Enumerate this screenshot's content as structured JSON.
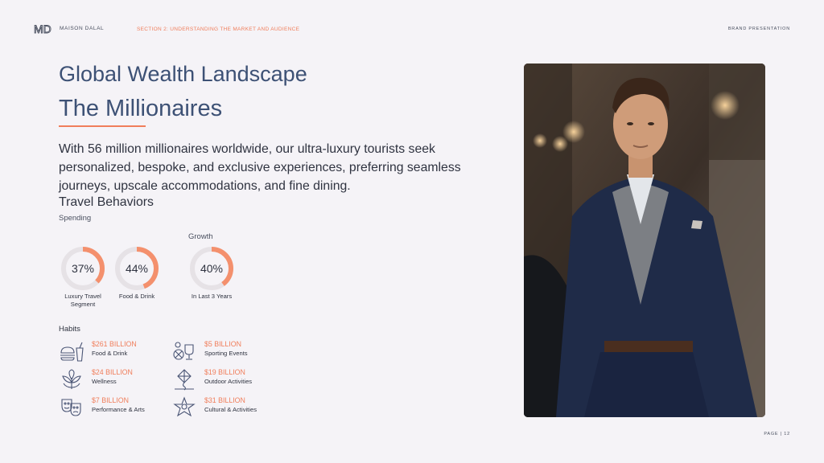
{
  "header": {
    "logo_mark": "MD",
    "logo_text": "MAISON DALAL",
    "section": "SECTION 2: UNDERSTANDING THE MARKET AND AUDIENCE",
    "brand": "BRAND PRESENTATION"
  },
  "title": "Global Wealth Landscape",
  "subtitle": "The Millionaires",
  "body": "With 56 million millionaires worldwide, our ultra-luxury tourists seek personalized, bespoke, and exclusive experiences, preferring seamless journeys, upscale accommodations, and fine dining.",
  "travel_heading": "Travel Behaviors",
  "spending_label": "Spending",
  "growth_label": "Growth",
  "stats": [
    {
      "value": "37%",
      "fraction": 0.37,
      "caption_1": "Luxury Travel",
      "caption_2": "Segment"
    },
    {
      "value": "44%",
      "fraction": 0.44,
      "caption_1": "Food & Drink",
      "caption_2": ""
    },
    {
      "value": "40%",
      "fraction": 0.4,
      "caption_1": "In Last 3 Years",
      "caption_2": ""
    }
  ],
  "habits_label": "Habits",
  "habits": [
    {
      "amount": "$261 BILLION",
      "name": "Food & Drink",
      "icon": "food-drink-icon"
    },
    {
      "amount": "$5 BILLION",
      "name": "Sporting Events",
      "icon": "sports-icon"
    },
    {
      "amount": "$24 BILLION",
      "name": "Wellness",
      "icon": "wellness-leaf-icon"
    },
    {
      "amount": "$19 BILLION",
      "name": "Outdoor Activities",
      "icon": "outdoor-kite-icon"
    },
    {
      "amount": "$7 BILLION",
      "name": "Performance & Arts",
      "icon": "theater-masks-icon"
    },
    {
      "amount": "$31 BILLION",
      "name": "Cultural & Activities",
      "icon": "culture-star-icon"
    }
  ],
  "page": "PAGE | 12",
  "colors": {
    "accent": "#f07e5b",
    "title": "#3d5175",
    "ring_track": "#e6e2e6"
  }
}
